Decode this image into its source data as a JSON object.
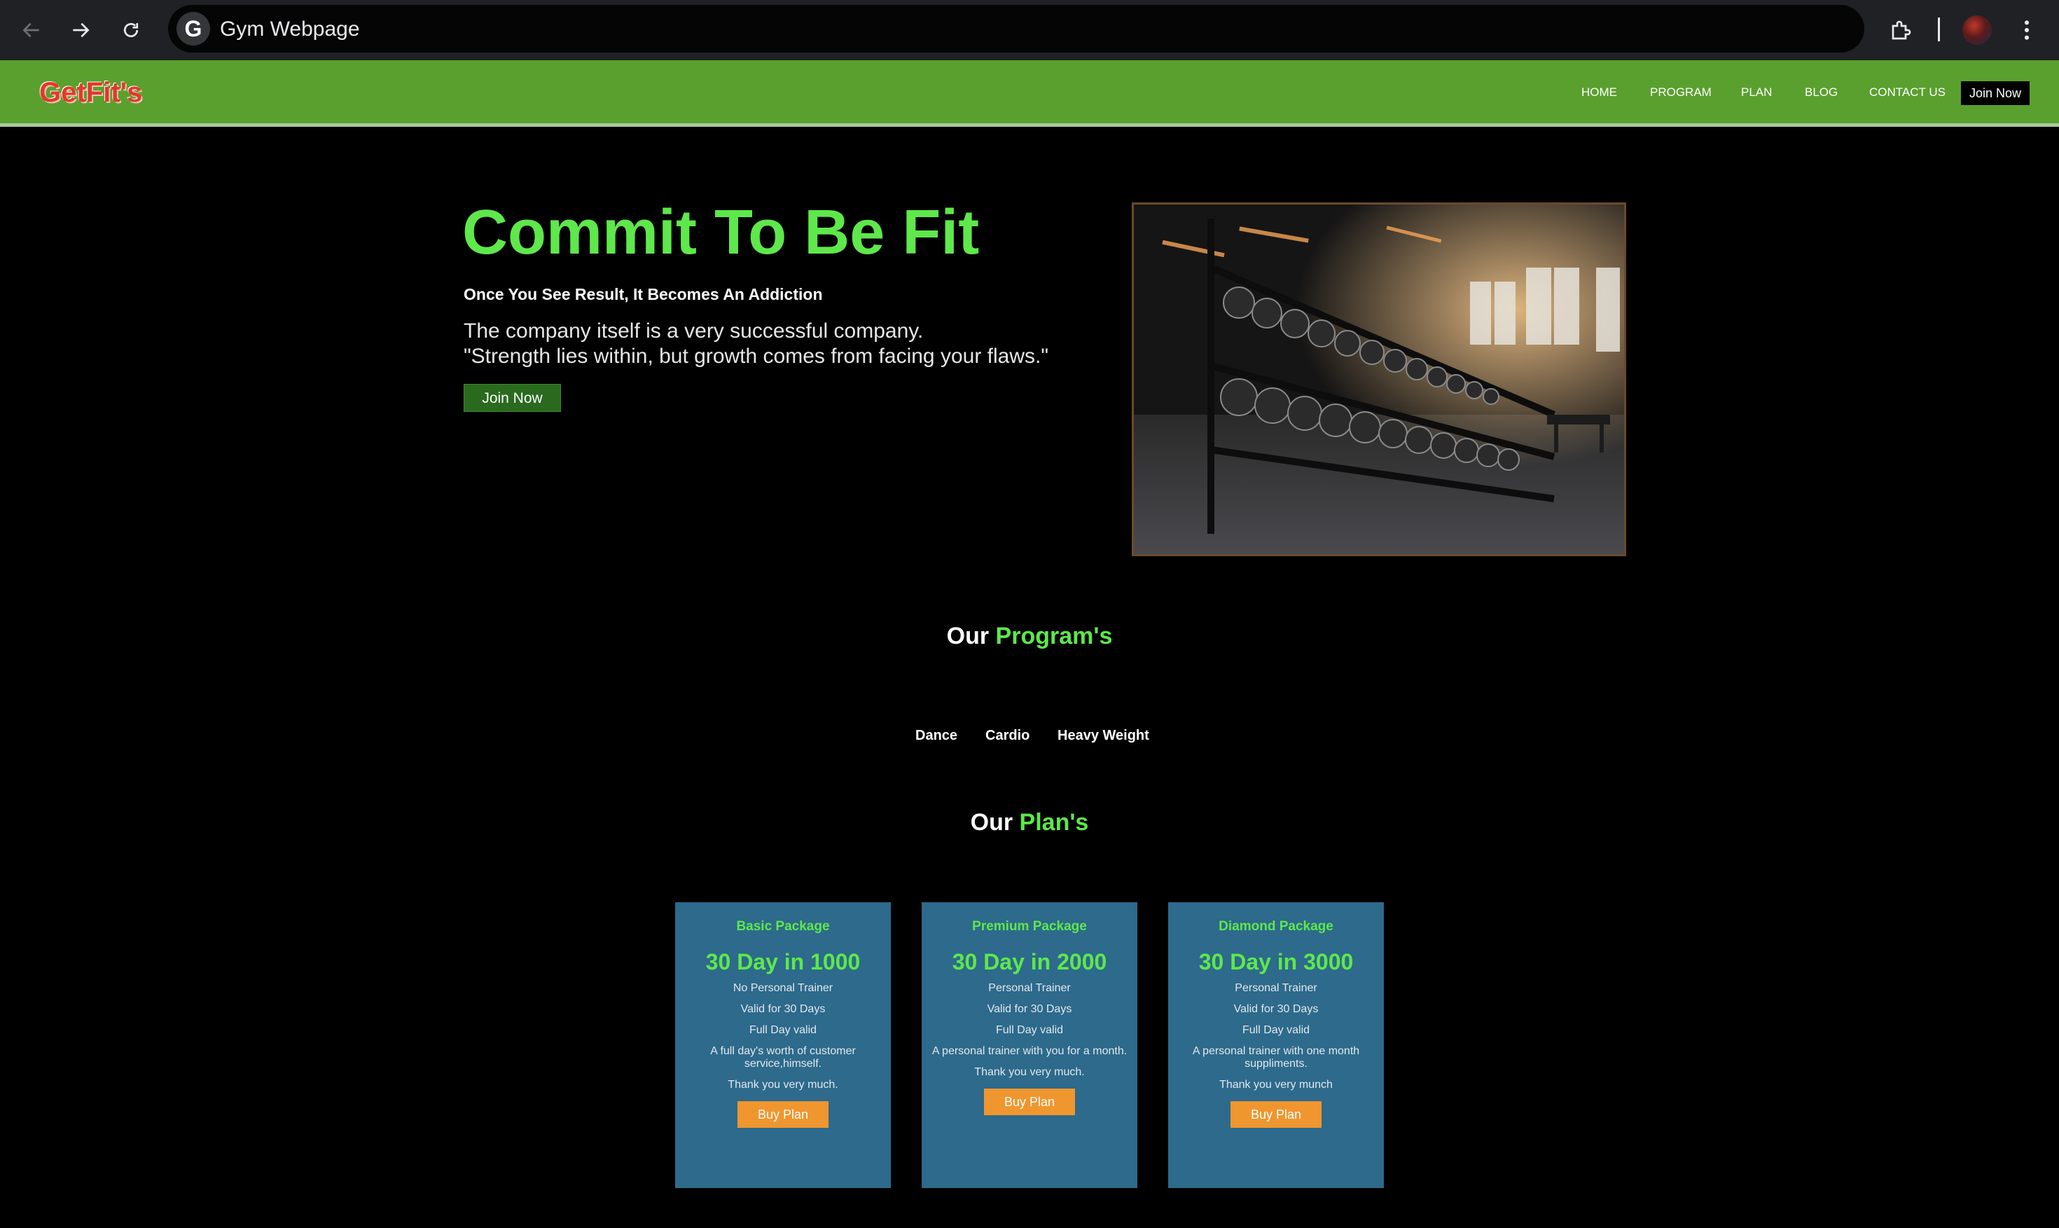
{
  "browser": {
    "tab_title": "Gym Webpage",
    "google_icon": "G"
  },
  "site": {
    "logo": "GetFit's",
    "nav": [
      "HOME",
      "PROGRAM",
      "PLAN",
      "BLOG",
      "CONTACT US"
    ],
    "join_now": "Join Now"
  },
  "hero": {
    "title": "Commit To Be Fit",
    "subtitle": "Once You See Result, It Becomes An Addiction",
    "line1": "The company itself is a very successful company.",
    "line2": "\"Strength lies within, but growth comes from facing your flaws.\"",
    "button": "Join Now"
  },
  "programs": {
    "title_white": "Our",
    "title_green": "Program's",
    "items": [
      "Dance",
      "Cardio",
      "Heavy Weight"
    ]
  },
  "plans": {
    "title_white": "Our",
    "title_green": "Plan's",
    "cards": [
      {
        "name": "Basic Package",
        "price": "30 Day in 1000",
        "lines": [
          "No Personal Trainer",
          "Valid for 30 Days",
          "Full Day valid",
          "A full day's worth of customer service,himself.",
          "Thank you very much."
        ],
        "button": "Buy Plan"
      },
      {
        "name": "Premium Package",
        "price": "30 Day in 2000",
        "lines": [
          "Personal Trainer",
          "Valid for 30 Days",
          "Full Day valid",
          "A personal trainer with you for a month.",
          "Thank you very much."
        ],
        "button": "Buy Plan"
      },
      {
        "name": "Diamond Package",
        "price": "30 Day in 3000",
        "lines": [
          "Personal Trainer",
          "Valid for 30 Days",
          "Full Day valid",
          "A personal trainer with one month suppliments.",
          "Thank you very munch"
        ],
        "button": "Buy Plan"
      }
    ]
  },
  "colors": {
    "nav_green": "#5aa02e",
    "accent_green": "#5ee84b",
    "card_blue": "#2d6a8c",
    "button_orange": "#f0962e"
  }
}
